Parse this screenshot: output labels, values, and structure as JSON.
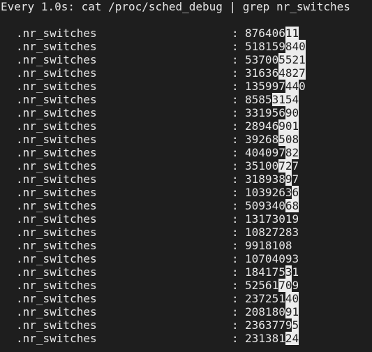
{
  "header": {
    "text": "Every 1.0s: cat /proc/sched_debug | grep nr_switches"
  },
  "rows": [
    {
      "key": ".nr_switches",
      "sep": ":",
      "value": "87640611",
      "hl_start": 6,
      "hl_end": 7
    },
    {
      "key": ".nr_switches",
      "sep": ":",
      "value": "518159840",
      "hl_start": 6,
      "hl_end": 8
    },
    {
      "key": ".nr_switches",
      "sep": ":",
      "value": "537005521",
      "hl_start": 5,
      "hl_end": 8
    },
    {
      "key": ".nr_switches",
      "sep": ":",
      "value": "316364827",
      "hl_start": 5,
      "hl_end": 8
    },
    {
      "key": ".nr_switches",
      "sep": ":",
      "value": "135997440",
      "hl_start": 6,
      "hl_end": 7
    },
    {
      "key": ".nr_switches",
      "sep": ":",
      "value": "85853154",
      "hl_start": 4,
      "hl_end": 7
    },
    {
      "key": ".nr_switches",
      "sep": ":",
      "value": "33195690",
      "hl_start": 6,
      "hl_end": 7
    },
    {
      "key": ".nr_switches",
      "sep": ":",
      "value": "28946901",
      "hl_start": 5,
      "hl_end": 7
    },
    {
      "key": ".nr_switches",
      "sep": ":",
      "value": "39268508",
      "hl_start": 5,
      "hl_end": 7
    },
    {
      "key": ".nr_switches",
      "sep": ":",
      "value": "40409782",
      "hl_start": 6,
      "hl_end": 7
    },
    {
      "key": ".nr_switches",
      "sep": ":",
      "value": "35100727",
      "hl_start": 5,
      "hl_end": 6
    },
    {
      "key": ".nr_switches",
      "sep": ":",
      "value": "31893897",
      "hl_start": 6,
      "hl_end": 6
    },
    {
      "key": ".nr_switches",
      "sep": ":",
      "value": "10392636",
      "hl_start": 7,
      "hl_end": 7
    },
    {
      "key": ".nr_switches",
      "sep": ":",
      "value": "50934068",
      "hl_start": 6,
      "hl_end": 7
    },
    {
      "key": ".nr_switches",
      "sep": ":",
      "value": "13173019",
      "hl_start": -1,
      "hl_end": -1
    },
    {
      "key": ".nr_switches",
      "sep": ":",
      "value": "10827283",
      "hl_start": -1,
      "hl_end": -1
    },
    {
      "key": ".nr_switches",
      "sep": ":",
      "value": "9918108",
      "hl_start": -1,
      "hl_end": -1
    },
    {
      "key": ".nr_switches",
      "sep": ":",
      "value": "10704093",
      "hl_start": -1,
      "hl_end": -1
    },
    {
      "key": ".nr_switches",
      "sep": ":",
      "value": "18417531",
      "hl_start": 6,
      "hl_end": 6
    },
    {
      "key": ".nr_switches",
      "sep": ":",
      "value": "52561709",
      "hl_start": 5,
      "hl_end": 6
    },
    {
      "key": ".nr_switches",
      "sep": ":",
      "value": "23725140",
      "hl_start": 6,
      "hl_end": 7
    },
    {
      "key": ".nr_switches",
      "sep": ":",
      "value": "20818091",
      "hl_start": 6,
      "hl_end": 7
    },
    {
      "key": ".nr_switches",
      "sep": ":",
      "value": "23637795",
      "hl_start": 7,
      "hl_end": 7
    },
    {
      "key": ".nr_switches",
      "sep": ":",
      "value": "23138124",
      "hl_start": 6,
      "hl_end": 7
    }
  ],
  "colors": {
    "background": "#1e1e1e",
    "foreground": "#e6e6e6",
    "highlight_bg": "#ececec",
    "highlight_fg": "#1e1e1e"
  }
}
